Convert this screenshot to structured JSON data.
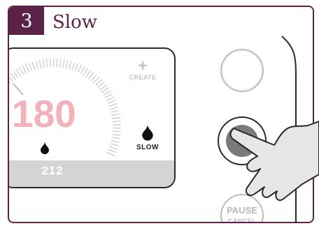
{
  "header": {
    "step_number": "3",
    "title": "Slow"
  },
  "screen": {
    "temperature": "180",
    "tab_value": "212",
    "create_label": "CREATE",
    "slow_label": "SLOW",
    "plus_symbol": "+"
  },
  "buttons": {
    "pause_label": "PAUSE",
    "cancel_label": "CANCEL"
  },
  "colors": {
    "brand": "#5c2146",
    "temperature": "#f3b1bc",
    "strip": "#d4d4d4",
    "hand": "#e6e6e6"
  },
  "icons": {
    "drop": "water-drop-icon",
    "arrow": "pointer-arrow-icon",
    "hand": "hand-pointer-icon"
  }
}
